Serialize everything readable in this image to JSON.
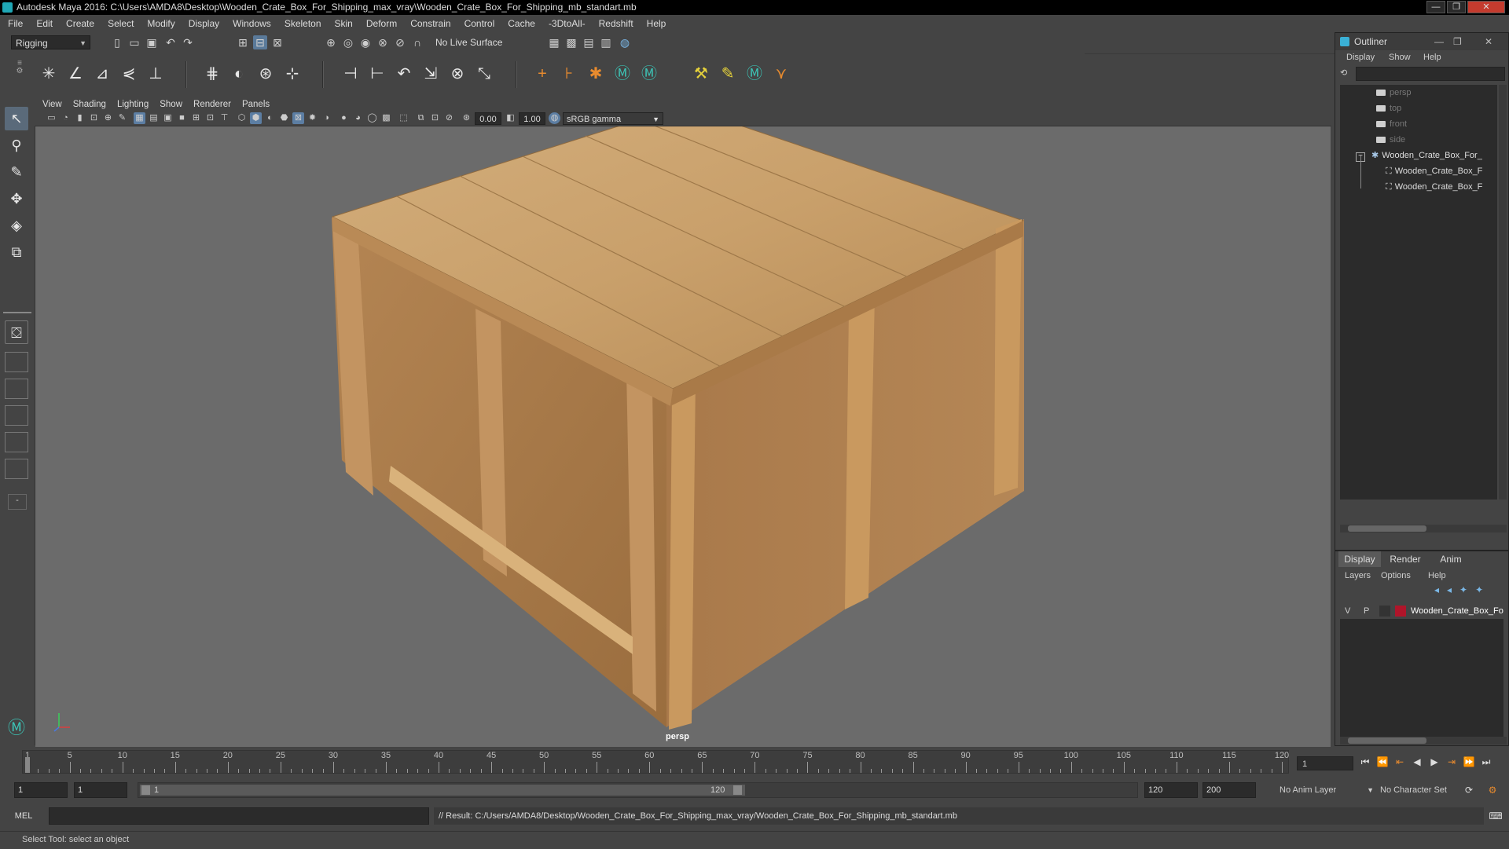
{
  "window": {
    "title": "Autodesk Maya 2016: C:\\Users\\AMDA8\\Desktop\\Wooden_Crate_Box_For_Shipping_max_vray\\Wooden_Crate_Box_For_Shipping_mb_standart.mb",
    "minimize": "—",
    "restore": "❐",
    "close": "✕"
  },
  "menu": [
    "File",
    "Edit",
    "Create",
    "Select",
    "Modify",
    "Display",
    "Windows",
    "Skeleton",
    "Skin",
    "Deform",
    "Constrain",
    "Control",
    "Cache",
    "-3DtoAll-",
    "Redshift",
    "Help"
  ],
  "statusline": {
    "menu_set": "Rigging",
    "live_surface": "No Live Surface"
  },
  "panel": {
    "menus": [
      "View",
      "Shading",
      "Lighting",
      "Show",
      "Renderer",
      "Panels"
    ],
    "exposure": "0.00",
    "gamma": "1.00",
    "color_space": "sRGB gamma",
    "camera_label": "persp"
  },
  "outliner": {
    "title": "Outliner",
    "menus": [
      "Display",
      "Show",
      "Help"
    ],
    "items": [
      {
        "label": "persp",
        "type": "camera",
        "depth": 0
      },
      {
        "label": "top",
        "type": "camera",
        "depth": 0
      },
      {
        "label": "front",
        "type": "camera",
        "depth": 0
      },
      {
        "label": "side",
        "type": "camera",
        "depth": 0
      },
      {
        "label": "Wooden_Crate_Box_For_",
        "type": "group",
        "depth": 0
      },
      {
        "label": "Wooden_Crate_Box_F",
        "type": "mesh",
        "depth": 1
      },
      {
        "label": "Wooden_Crate_Box_F",
        "type": "mesh",
        "depth": 1
      }
    ]
  },
  "layers": {
    "tabs": [
      "Display",
      "Render",
      "Anim"
    ],
    "menus": [
      "Layers",
      "Options",
      "Help"
    ],
    "row": {
      "v": "V",
      "p": "P",
      "name": "Wooden_Crate_Box_Fo",
      "color": "#b0152a"
    }
  },
  "timeline": {
    "ticks": [
      "1",
      "5",
      "10",
      "15",
      "20",
      "25",
      "30",
      "35",
      "40",
      "45",
      "50",
      "55",
      "60",
      "65",
      "70",
      "75",
      "80",
      "85",
      "90",
      "95",
      "100",
      "105",
      "110",
      "115",
      "120"
    ],
    "current_frame": "1"
  },
  "range": {
    "start": "1",
    "playback_start": "1",
    "slider_start": "1",
    "slider_end": "120",
    "playback_end": "120",
    "end": "200",
    "anim_layer": "No Anim Layer",
    "character_set": "No Character Set"
  },
  "commandline": {
    "lang": "MEL",
    "result": "// Result: C:/Users/AMDA8/Desktop/Wooden_Crate_Box_For_Shipping_max_vray/Wooden_Crate_Box_For_Shipping_mb_standart.mb"
  },
  "helpline": {
    "text": "Select Tool: select an object"
  }
}
